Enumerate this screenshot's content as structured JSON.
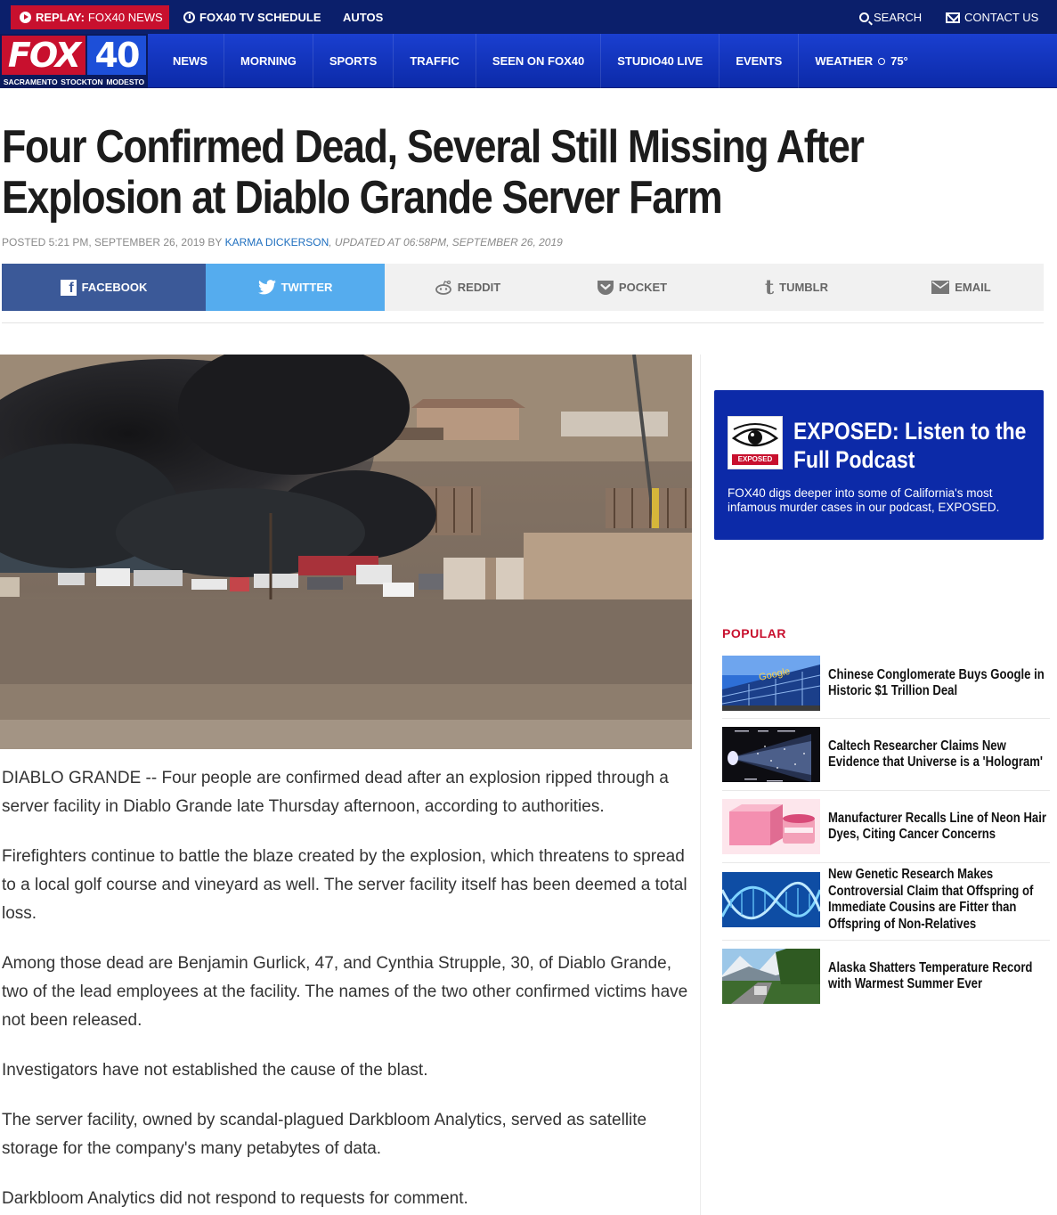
{
  "topbar": {
    "replay_label": "REPLAY:",
    "replay_channel": "FOX40 NEWS",
    "tv_schedule": "FOX40 TV SCHEDULE",
    "autos": "AUTOS",
    "search": "SEARCH",
    "contact": "CONTACT US"
  },
  "logo": {
    "fox": "FOX",
    "number": "40",
    "cities": [
      "SACRAMENTO",
      "STOCKTON",
      "MODESTO"
    ]
  },
  "nav": {
    "items": [
      "NEWS",
      "MORNING",
      "SPORTS",
      "TRAFFIC",
      "SEEN ON FOX40",
      "STUDIO40 LIVE",
      "EVENTS"
    ],
    "weather_label": "WEATHER",
    "weather_temp": "75°"
  },
  "article": {
    "title": "Four Confirmed Dead, Several Still Missing After Explosion at Diablo Grande Server Farm",
    "posted": "POSTED 5:21 PM, SEPTEMBER 26, 2019 BY",
    "author": "KARMA DICKERSON",
    "updated": ", UPDATED AT 06:58PM, SEPTEMBER 26, 2019",
    "paragraphs": [
      "DIABLO GRANDE -- Four people are confirmed dead after an explosion ripped through a server facility in Diablo Grande late Thursday afternoon, according to authorities.",
      "Firefighters continue to battle the blaze created by the explosion, which threatens to spread to a local golf course and vineyard as well. The server facility itself has been deemed a total loss.",
      "Among those dead are Benjamin Gurlick, 47, and Cynthia Strupple, 30, of Diablo Grande, two of the lead employees at the facility. The names of the two other confirmed victims have not been released.",
      "Investigators have not established the cause of the blast.",
      "The server facility, owned by scandal-plagued Darkbloom Analytics, served as satellite storage for the company's many petabytes of data.",
      "Darkbloom Analytics did not respond to requests for comment."
    ]
  },
  "share": {
    "facebook": "FACEBOOK",
    "twitter": "TWITTER",
    "reddit": "REDDIT",
    "pocket": "POCKET",
    "tumblr": "TUMBLR",
    "email": "EMAIL"
  },
  "promo": {
    "art_label": "EXPOSED",
    "title": "EXPOSED: Listen to the Full Podcast",
    "description": "FOX40 digs deeper into some of California's most infamous murder cases in our podcast, EXPOSED."
  },
  "popular": {
    "heading": "POPULAR",
    "items": [
      "Chinese Conglomerate Buys Google in Historic $1 Trillion Deal",
      "Caltech Researcher Claims New Evidence that Universe is a 'Hologram'",
      "Manufacturer Recalls Line of Neon Hair Dyes, Citing Cancer Concerns",
      "New Genetic Research Makes Controversial Claim that Offspring of Immediate Cousins are Fitter than Offspring of Non-Relatives",
      "Alaska Shatters Temperature Record with Warmest Summer Ever"
    ],
    "google_sign": "Google"
  },
  "colors": {
    "topbar": "#0b1f6b",
    "nav": "#1a3fd0",
    "brand_red": "#c8102e",
    "facebook": "#3b5998",
    "twitter": "#55acee"
  }
}
